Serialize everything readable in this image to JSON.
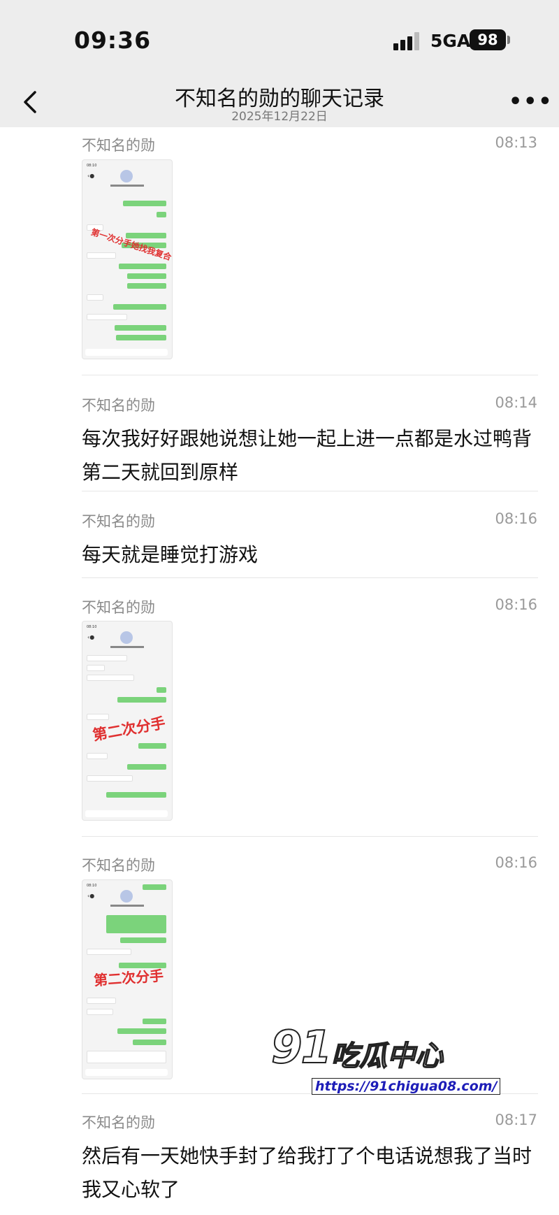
{
  "status_bar": {
    "time": "09:36",
    "network": "5GA",
    "battery": "98"
  },
  "nav": {
    "title": "不知名的勋的聊天记录",
    "date": "2025年12月22日"
  },
  "messages": [
    {
      "sender": "不知名的勋",
      "time": "08:13",
      "type": "image"
    },
    {
      "sender": "不知名的勋",
      "time": "08:14",
      "type": "text",
      "text": "每次我好好跟她说想让她一起上进一点都是水过鸭背第二天就回到原样"
    },
    {
      "sender": "不知名的勋",
      "time": "08:16",
      "type": "text",
      "text": "每天就是睡觉打游戏"
    },
    {
      "sender": "不知名的勋",
      "time": "08:16",
      "type": "image",
      "stamp": "第二次分手"
    },
    {
      "sender": "不知名的勋",
      "time": "08:16",
      "type": "image",
      "stamp": "第二次分手"
    },
    {
      "sender": "不知名的勋",
      "time": "08:17",
      "type": "text",
      "text": "然后有一天她快手封了给我打了个电话说想我了当时我又心软了"
    }
  ],
  "image_thumbs": [
    {
      "status_time": "08:10",
      "stamp": "第一次分手她找我复合"
    },
    {
      "status_time": "08:10",
      "stamp": "第二次分手"
    },
    {
      "status_time": "08:10",
      "stamp": "第二次分手"
    }
  ],
  "watermark": {
    "logo": "91",
    "name": "吃瓜中心",
    "url": "https://91chigua08.com/"
  },
  "colors": {
    "nav_bg": "#ededed",
    "bubble_green": "#7bd37b",
    "stamp_red": "#e03030"
  }
}
